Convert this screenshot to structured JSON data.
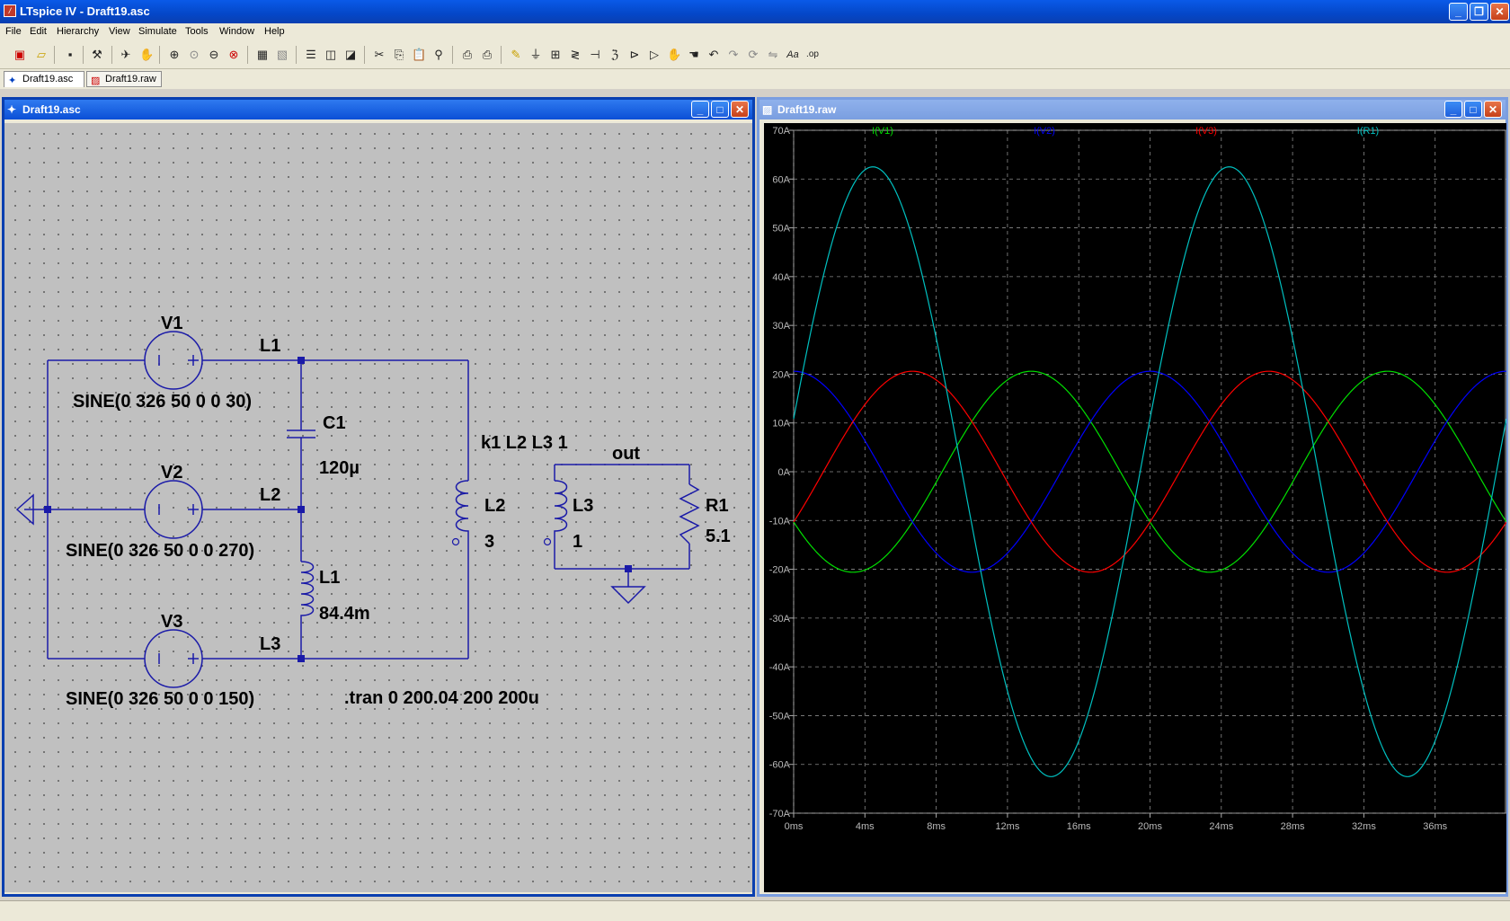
{
  "app": {
    "title": "LTspice IV - Draft19.asc"
  },
  "menu": [
    "File",
    "Edit",
    "Hierarchy",
    "View",
    "Simulate",
    "Tools",
    "Window",
    "Help"
  ],
  "tabs": [
    {
      "label": "Draft19.asc"
    },
    {
      "label": "Draft19.raw"
    }
  ],
  "schematic_window": {
    "title": "Draft19.asc"
  },
  "plot_window": {
    "title": "Draft19.raw"
  },
  "schematic": {
    "sources": [
      {
        "name": "V1",
        "value": "SINE(0 326 50 0 0 30)",
        "net": "L1"
      },
      {
        "name": "V2",
        "value": "SINE(0 326 50 0 0 270)",
        "net": "L2"
      },
      {
        "name": "V3",
        "value": "SINE(0 326 50 0 0 150)",
        "net": "L3"
      }
    ],
    "c1": {
      "name": "C1",
      "value": "120µ"
    },
    "l1": {
      "name": "L1",
      "value": "84.4m"
    },
    "l2": {
      "name": "L2",
      "value": "3"
    },
    "l3": {
      "name": "L3",
      "value": "1"
    },
    "r1": {
      "name": "R1",
      "value": "5.1"
    },
    "coupling": "k1 L2 L3 1",
    "out_label": "out",
    "directive": ".tran 0 200.04 200 200u"
  },
  "chart_data": {
    "type": "line",
    "xlabel": "",
    "ylabel": "",
    "xlim": [
      0,
      40
    ],
    "ylim": [
      -70,
      70
    ],
    "xticks": [
      "0ms",
      "4ms",
      "8ms",
      "12ms",
      "16ms",
      "20ms",
      "24ms",
      "28ms",
      "32ms",
      "36ms"
    ],
    "yticks": [
      "70A",
      "60A",
      "50A",
      "40A",
      "30A",
      "20A",
      "10A",
      "0A",
      "-10A",
      "-20A",
      "-30A",
      "-40A",
      "-50A",
      "-60A",
      "-70A"
    ],
    "grid": true,
    "legend": "top",
    "series": [
      {
        "name": "I(V1)",
        "color": "#00e000",
        "amplitude": 20.6,
        "frequency_hz": 50,
        "phase_deg": 210
      },
      {
        "name": "I(V2)",
        "color": "#0000ff",
        "amplitude": 20.6,
        "frequency_hz": 50,
        "phase_deg": 90
      },
      {
        "name": "I(V3)",
        "color": "#ff0000",
        "amplitude": 20.6,
        "frequency_hz": 50,
        "phase_deg": 330
      },
      {
        "name": "I(R1)",
        "color": "#00c0c0",
        "amplitude": 62.5,
        "frequency_hz": 50,
        "phase_deg": 10
      }
    ]
  }
}
